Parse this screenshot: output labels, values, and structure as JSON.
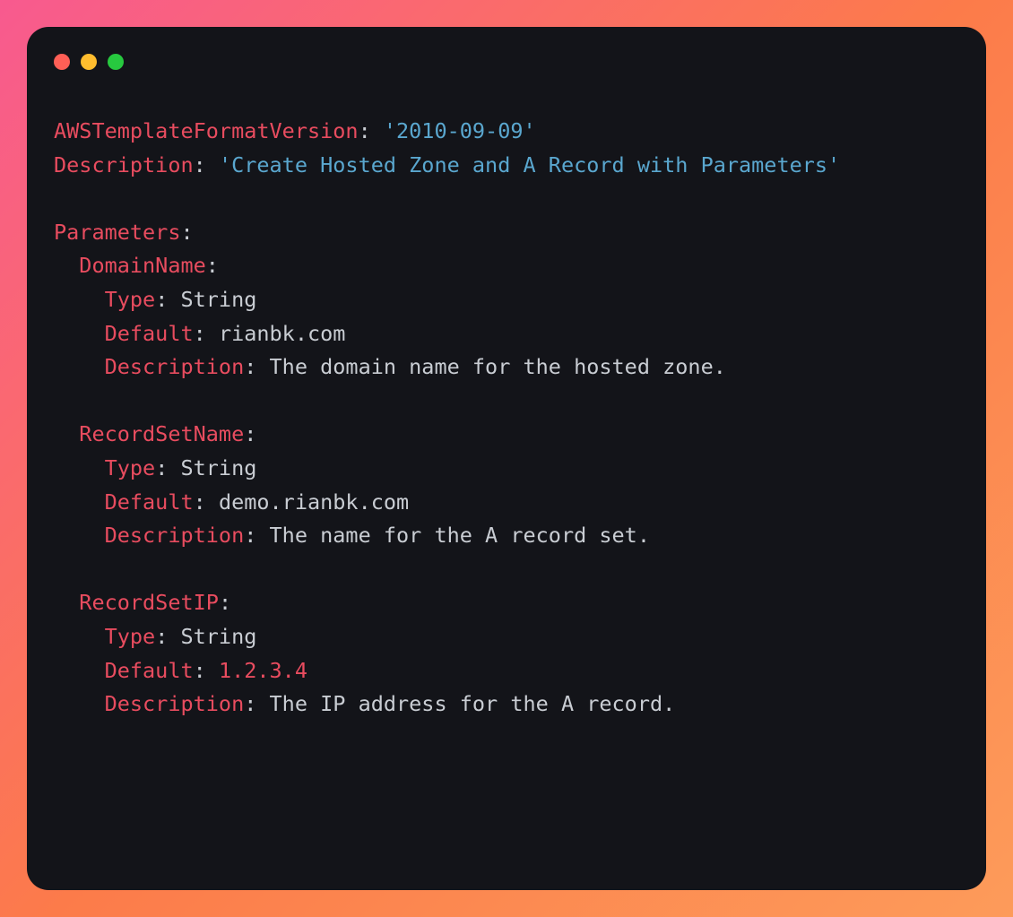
{
  "code": {
    "line1_key": "AWSTemplateFormatVersion",
    "line1_punc": ": ",
    "line1_val": "'2010-09-09'",
    "line2_key": "Description",
    "line2_punc": ": ",
    "line2_val": "'Create Hosted Zone and A Record with Parameters'",
    "params_key": "Parameters",
    "params_punc": ":",
    "domain_key": "DomainName",
    "domain_punc": ":",
    "domain_type_key": "Type",
    "domain_type_punc": ": ",
    "domain_type_val": "String",
    "domain_default_key": "Default",
    "domain_default_punc": ": ",
    "domain_default_val": "rianbk.com",
    "domain_desc_key": "Description",
    "domain_desc_punc": ": ",
    "domain_desc_val": "The domain name for the hosted zone.",
    "record_key": "RecordSetName",
    "record_punc": ":",
    "record_type_key": "Type",
    "record_type_punc": ": ",
    "record_type_val": "String",
    "record_default_key": "Default",
    "record_default_punc": ": ",
    "record_default_val": "demo.rianbk.com",
    "record_desc_key": "Description",
    "record_desc_punc": ": ",
    "record_desc_val": "The name for the A record set.",
    "ip_key": "RecordSetIP",
    "ip_punc": ":",
    "ip_type_key": "Type",
    "ip_type_punc": ": ",
    "ip_type_val": "String",
    "ip_default_key": "Default",
    "ip_default_punc": ": ",
    "ip_default_val": "1.2.3.4",
    "ip_desc_key": "Description",
    "ip_desc_punc": ": ",
    "ip_desc_val": "The IP address for the A record."
  }
}
